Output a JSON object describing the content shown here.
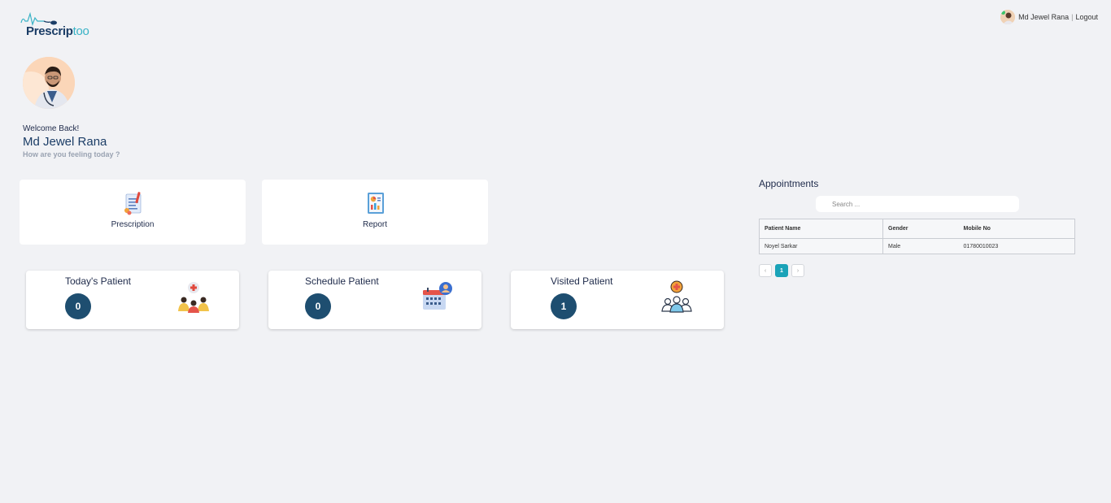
{
  "brand": {
    "name_main": "Prescrip",
    "name_accent": "too"
  },
  "header": {
    "user_name": "Md Jewel Rana",
    "separator": "|",
    "logout_label": "Logout"
  },
  "profile": {
    "welcome": "Welcome Back!",
    "name": "Md Jewel Rana",
    "feeling": "How are you feeling today ?"
  },
  "menu": [
    {
      "label": "Prescription",
      "icon": "prescription-icon"
    },
    {
      "label": "Report",
      "icon": "report-icon"
    }
  ],
  "stats": [
    {
      "title": "Today's Patient",
      "count": "0",
      "icon": "patients-icon"
    },
    {
      "title": "Schedule Patient",
      "count": "0",
      "icon": "calendar-icon"
    },
    {
      "title": "Visited Patient",
      "count": "1",
      "icon": "group-icon"
    }
  ],
  "appointments": {
    "title": "Appointments",
    "search_placeholder": "Search ...",
    "columns": [
      "Patient Name",
      "Gender",
      "Mobile No"
    ],
    "rows": [
      [
        "Noyel Sarkar",
        "Male",
        "01780010023"
      ]
    ],
    "pagination": {
      "prev": "‹",
      "current": "1",
      "next": "›"
    }
  },
  "colors": {
    "accent": "#1aa3b8",
    "badge": "#1e4e70",
    "background": "#f1f2f5",
    "brand_dark": "#1b3d66"
  }
}
